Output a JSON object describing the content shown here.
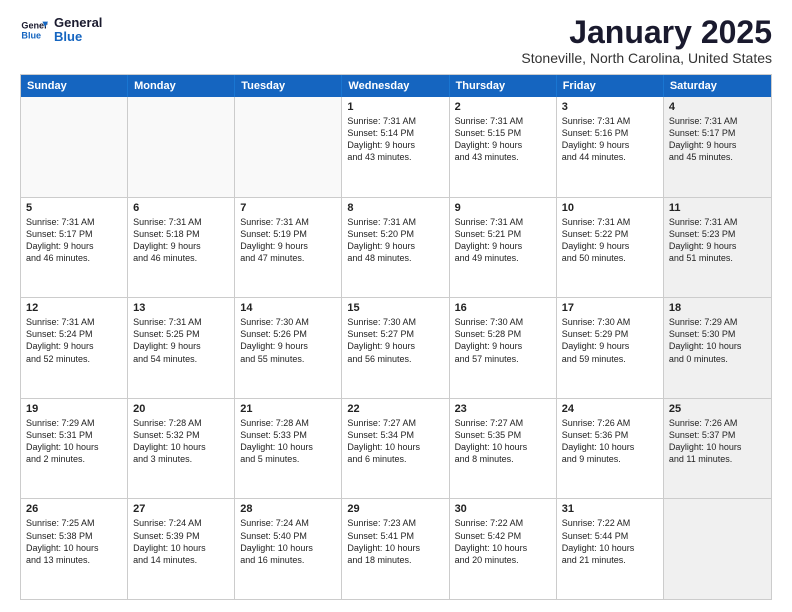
{
  "header": {
    "logo_general": "General",
    "logo_blue": "Blue",
    "month_title": "January 2025",
    "location": "Stoneville, North Carolina, United States"
  },
  "weekdays": [
    "Sunday",
    "Monday",
    "Tuesday",
    "Wednesday",
    "Thursday",
    "Friday",
    "Saturday"
  ],
  "rows": [
    [
      {
        "day": "",
        "text": "",
        "empty": true
      },
      {
        "day": "",
        "text": "",
        "empty": true
      },
      {
        "day": "",
        "text": "",
        "empty": true
      },
      {
        "day": "1",
        "text": "Sunrise: 7:31 AM\nSunset: 5:14 PM\nDaylight: 9 hours\nand 43 minutes.",
        "empty": false
      },
      {
        "day": "2",
        "text": "Sunrise: 7:31 AM\nSunset: 5:15 PM\nDaylight: 9 hours\nand 43 minutes.",
        "empty": false
      },
      {
        "day": "3",
        "text": "Sunrise: 7:31 AM\nSunset: 5:16 PM\nDaylight: 9 hours\nand 44 minutes.",
        "empty": false
      },
      {
        "day": "4",
        "text": "Sunrise: 7:31 AM\nSunset: 5:17 PM\nDaylight: 9 hours\nand 45 minutes.",
        "empty": false,
        "shaded": true
      }
    ],
    [
      {
        "day": "5",
        "text": "Sunrise: 7:31 AM\nSunset: 5:17 PM\nDaylight: 9 hours\nand 46 minutes.",
        "empty": false
      },
      {
        "day": "6",
        "text": "Sunrise: 7:31 AM\nSunset: 5:18 PM\nDaylight: 9 hours\nand 46 minutes.",
        "empty": false
      },
      {
        "day": "7",
        "text": "Sunrise: 7:31 AM\nSunset: 5:19 PM\nDaylight: 9 hours\nand 47 minutes.",
        "empty": false
      },
      {
        "day": "8",
        "text": "Sunrise: 7:31 AM\nSunset: 5:20 PM\nDaylight: 9 hours\nand 48 minutes.",
        "empty": false
      },
      {
        "day": "9",
        "text": "Sunrise: 7:31 AM\nSunset: 5:21 PM\nDaylight: 9 hours\nand 49 minutes.",
        "empty": false
      },
      {
        "day": "10",
        "text": "Sunrise: 7:31 AM\nSunset: 5:22 PM\nDaylight: 9 hours\nand 50 minutes.",
        "empty": false
      },
      {
        "day": "11",
        "text": "Sunrise: 7:31 AM\nSunset: 5:23 PM\nDaylight: 9 hours\nand 51 minutes.",
        "empty": false,
        "shaded": true
      }
    ],
    [
      {
        "day": "12",
        "text": "Sunrise: 7:31 AM\nSunset: 5:24 PM\nDaylight: 9 hours\nand 52 minutes.",
        "empty": false
      },
      {
        "day": "13",
        "text": "Sunrise: 7:31 AM\nSunset: 5:25 PM\nDaylight: 9 hours\nand 54 minutes.",
        "empty": false
      },
      {
        "day": "14",
        "text": "Sunrise: 7:30 AM\nSunset: 5:26 PM\nDaylight: 9 hours\nand 55 minutes.",
        "empty": false
      },
      {
        "day": "15",
        "text": "Sunrise: 7:30 AM\nSunset: 5:27 PM\nDaylight: 9 hours\nand 56 minutes.",
        "empty": false
      },
      {
        "day": "16",
        "text": "Sunrise: 7:30 AM\nSunset: 5:28 PM\nDaylight: 9 hours\nand 57 minutes.",
        "empty": false
      },
      {
        "day": "17",
        "text": "Sunrise: 7:30 AM\nSunset: 5:29 PM\nDaylight: 9 hours\nand 59 minutes.",
        "empty": false
      },
      {
        "day": "18",
        "text": "Sunrise: 7:29 AM\nSunset: 5:30 PM\nDaylight: 10 hours\nand 0 minutes.",
        "empty": false,
        "shaded": true
      }
    ],
    [
      {
        "day": "19",
        "text": "Sunrise: 7:29 AM\nSunset: 5:31 PM\nDaylight: 10 hours\nand 2 minutes.",
        "empty": false
      },
      {
        "day": "20",
        "text": "Sunrise: 7:28 AM\nSunset: 5:32 PM\nDaylight: 10 hours\nand 3 minutes.",
        "empty": false
      },
      {
        "day": "21",
        "text": "Sunrise: 7:28 AM\nSunset: 5:33 PM\nDaylight: 10 hours\nand 5 minutes.",
        "empty": false
      },
      {
        "day": "22",
        "text": "Sunrise: 7:27 AM\nSunset: 5:34 PM\nDaylight: 10 hours\nand 6 minutes.",
        "empty": false
      },
      {
        "day": "23",
        "text": "Sunrise: 7:27 AM\nSunset: 5:35 PM\nDaylight: 10 hours\nand 8 minutes.",
        "empty": false
      },
      {
        "day": "24",
        "text": "Sunrise: 7:26 AM\nSunset: 5:36 PM\nDaylight: 10 hours\nand 9 minutes.",
        "empty": false
      },
      {
        "day": "25",
        "text": "Sunrise: 7:26 AM\nSunset: 5:37 PM\nDaylight: 10 hours\nand 11 minutes.",
        "empty": false,
        "shaded": true
      }
    ],
    [
      {
        "day": "26",
        "text": "Sunrise: 7:25 AM\nSunset: 5:38 PM\nDaylight: 10 hours\nand 13 minutes.",
        "empty": false
      },
      {
        "day": "27",
        "text": "Sunrise: 7:24 AM\nSunset: 5:39 PM\nDaylight: 10 hours\nand 14 minutes.",
        "empty": false
      },
      {
        "day": "28",
        "text": "Sunrise: 7:24 AM\nSunset: 5:40 PM\nDaylight: 10 hours\nand 16 minutes.",
        "empty": false
      },
      {
        "day": "29",
        "text": "Sunrise: 7:23 AM\nSunset: 5:41 PM\nDaylight: 10 hours\nand 18 minutes.",
        "empty": false
      },
      {
        "day": "30",
        "text": "Sunrise: 7:22 AM\nSunset: 5:42 PM\nDaylight: 10 hours\nand 20 minutes.",
        "empty": false
      },
      {
        "day": "31",
        "text": "Sunrise: 7:22 AM\nSunset: 5:44 PM\nDaylight: 10 hours\nand 21 minutes.",
        "empty": false
      },
      {
        "day": "",
        "text": "",
        "empty": true,
        "shaded": true
      }
    ]
  ]
}
